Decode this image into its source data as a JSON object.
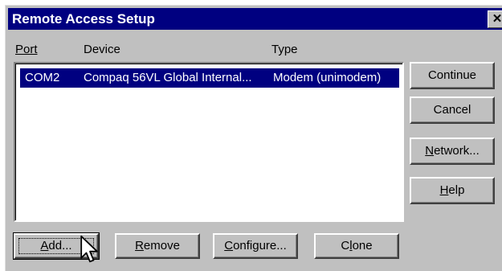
{
  "window": {
    "title": "Remote Access Setup",
    "close_glyph": "✕"
  },
  "columns": {
    "port": "Port",
    "device": "Device",
    "type": "Type"
  },
  "rows": [
    {
      "port": "COM2",
      "device": "Compaq 56VL Global Internal...",
      "type": "Modem (unimodem)"
    }
  ],
  "side_buttons": {
    "continue": "Continue",
    "cancel": "Cancel",
    "network": "Network...",
    "help": "Help"
  },
  "bottom_buttons": {
    "add": "Add...",
    "remove": "Remove",
    "configure": "Configure...",
    "clone": "Clone"
  },
  "icons": {
    "cursor": "arrow-cursor-icon",
    "close": "close-icon"
  },
  "colors": {
    "titlebar": "#000080",
    "selection": "#000080",
    "face": "#c0c0c0"
  }
}
